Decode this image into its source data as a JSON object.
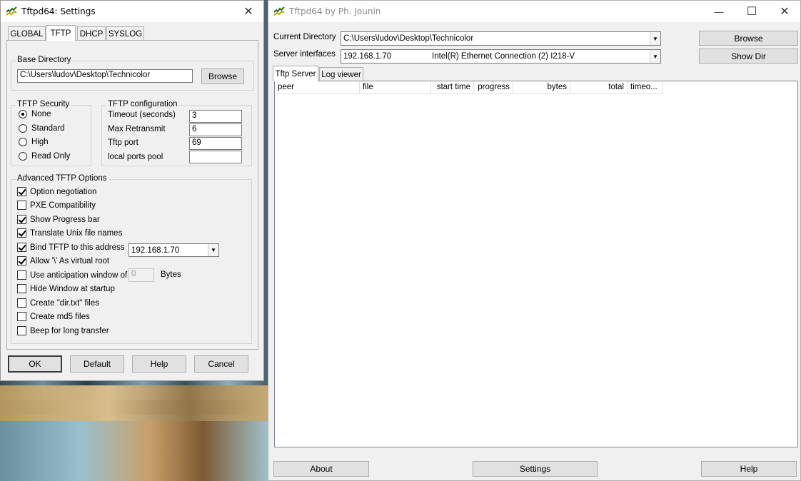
{
  "settings_window": {
    "title": "Tftpd64: Settings",
    "close_glyph": "✕",
    "tabs": [
      {
        "label": "GLOBAL"
      },
      {
        "label": "TFTP",
        "active": true
      },
      {
        "label": "DHCP"
      },
      {
        "label": "SYSLOG"
      }
    ],
    "base_directory": {
      "legend": "Base Directory",
      "value": "C:\\Users\\ludov\\Desktop\\Technicolor",
      "browse_label": "Browse"
    },
    "security": {
      "legend": "TFTP Security",
      "options": [
        {
          "label": "None",
          "selected": true
        },
        {
          "label": "Standard",
          "selected": false
        },
        {
          "label": "High",
          "selected": false
        },
        {
          "label": "Read Only",
          "selected": false
        }
      ]
    },
    "configuration": {
      "legend": "TFTP configuration",
      "timeout_label": "Timeout (seconds)",
      "timeout_value": "3",
      "retransmit_label": "Max Retransmit",
      "retransmit_value": "6",
      "port_label": "Tftp port",
      "port_value": "69",
      "ports_pool_label": "local ports pool",
      "ports_pool_value": ""
    },
    "advanced": {
      "legend": "Advanced TFTP Options",
      "options": [
        {
          "label": "Option negotiation",
          "checked": true
        },
        {
          "label": "PXE Compatibility",
          "checked": false
        },
        {
          "label": "Show Progress bar",
          "checked": true
        },
        {
          "label": "Translate Unix file names",
          "checked": true
        },
        {
          "label": "Bind TFTP to this address",
          "checked": true
        },
        {
          "label": "Allow '\\' As virtual root",
          "checked": true
        },
        {
          "label": "Use anticipation window of",
          "checked": false
        },
        {
          "label": "Hide Window at startup",
          "checked": false
        },
        {
          "label": "Create \"dir.txt\" files",
          "checked": false
        },
        {
          "label": "Create md5 files",
          "checked": false
        },
        {
          "label": "Beep for long transfer",
          "checked": false
        }
      ],
      "bind_address": "192.168.1.70",
      "anticipation_value": "0",
      "anticipation_unit": "Bytes"
    },
    "buttons": {
      "ok": "OK",
      "default": "Default",
      "help": "Help",
      "cancel": "Cancel"
    }
  },
  "main_window": {
    "title": "Tftpd64 by Ph. Jounin",
    "minimize_glyph": "—",
    "maximize_glyph": "☐",
    "close_glyph": "✕",
    "current_directory_label": "Current Directory",
    "current_directory_value": "C:\\Users\\ludov\\Desktop\\Technicolor",
    "server_interfaces_label": "Server interfaces",
    "server_interface_ip": "192.168.1.70",
    "server_interface_name": "Intel(R) Ethernet Connection (2) I218-V",
    "browse_label": "Browse",
    "show_dir_label": "Show Dir",
    "tabs": [
      {
        "label": "Tftp Server",
        "active": true
      },
      {
        "label": "Log viewer"
      }
    ],
    "columns": [
      "peer",
      "file",
      "start time",
      "progress",
      "bytes",
      "total",
      "timeo..."
    ],
    "buttons": {
      "about": "About",
      "settings": "Settings",
      "help": "Help"
    }
  },
  "icons": {
    "app_icon": "tftpd-app-icon",
    "dropdown": "chevron-down-icon"
  }
}
